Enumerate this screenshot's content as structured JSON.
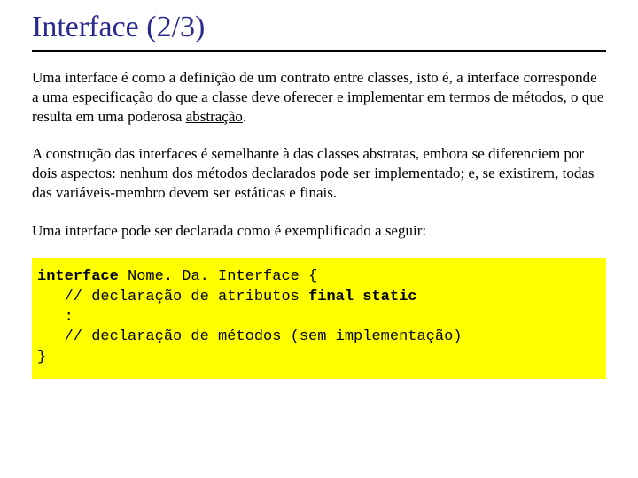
{
  "title": "Interface (2/3)",
  "paragraphs": {
    "p1_a": "Uma interface é como a definição de um contrato entre classes, isto é, a interface corresponde a uma especificação do que a classe deve oferecer e implementar em termos de métodos, o que resulta em uma poderosa ",
    "p1_u": "abstração",
    "p1_b": ".",
    "p2": "A construção das interfaces é semelhante à das classes abstratas, embora se diferenciem por dois aspectos: nenhum dos métodos declarados pode ser implementado; e, se existirem, todas das variáveis-membro devem ser estáticas e finais.",
    "p3": "Uma interface pode ser declarada como é exemplificado a seguir:"
  },
  "code": {
    "kw_interface": "interface",
    "cls_name": " Nome. Da. Interface {",
    "line2a": "   // declaração de atributos ",
    "kw_final_static": "final static",
    "line3": "   :",
    "line4": "   // declaração de métodos (sem implementação)",
    "line5": "}"
  }
}
